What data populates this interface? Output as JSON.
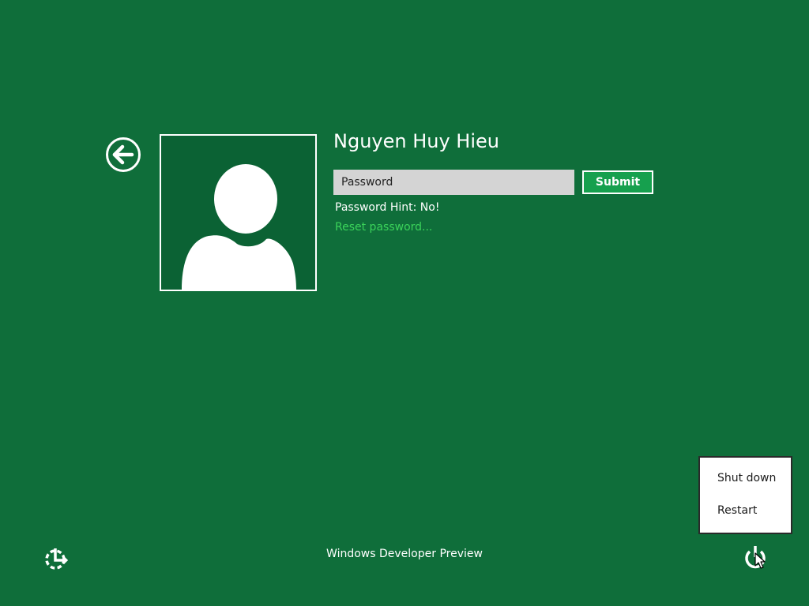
{
  "user": {
    "name": "Nguyen Huy Hieu"
  },
  "login": {
    "password_placeholder": "Password",
    "submit_label": "Submit",
    "hint_text": "Password Hint: No!",
    "reset_link": "Reset password..."
  },
  "footer": {
    "text": "Windows Developer Preview"
  },
  "power_menu": {
    "items": [
      {
        "label": "Shut down"
      },
      {
        "label": "Restart"
      }
    ]
  },
  "icons": {
    "back": "back-arrow-icon",
    "avatar": "user-silhouette-icon",
    "ease_of_access": "ease-of-access-icon",
    "power": "power-icon",
    "cursor": "mouse-cursor-icon"
  },
  "colors": {
    "background": "#0f6e3a",
    "avatar_background": "#0b6234",
    "submit_background": "#16a04e",
    "link": "#3bd35a",
    "input_background": "#d4d4d4"
  }
}
